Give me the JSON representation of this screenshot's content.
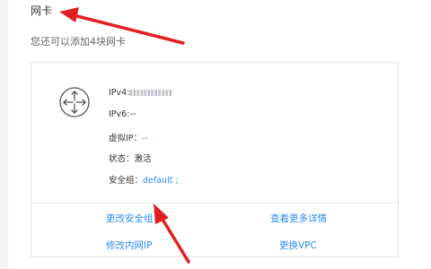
{
  "section": {
    "title": "网卡",
    "subtitle": "您还可以添加4块网卡"
  },
  "nic": {
    "ipv4_label": "IPv4:",
    "ipv6_label": "IPv6:",
    "ipv6_value": "--",
    "vip_label": "虚拟IP：",
    "vip_value": "--",
    "status_label": "状态：",
    "status_value": "激活",
    "sg_label": "安全组：",
    "sg_value": "default ;"
  },
  "actions": {
    "change_sg": "更改安全组",
    "view_details": "查看更多详情",
    "modify_ip": "修改内网IP",
    "change_vpc": "更换VPC"
  },
  "colors": {
    "link": "#2d8cf0",
    "arrow": "#e02020"
  },
  "icons": {
    "nic": "router-arrows-icon"
  }
}
